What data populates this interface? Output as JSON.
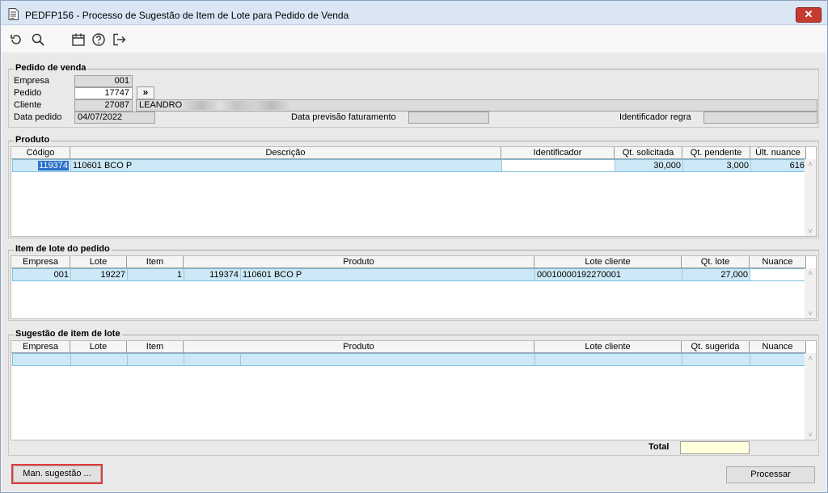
{
  "window": {
    "title": "PEDFP156 - Processo de Sugestão de Item de Lote para Pedido de Venda",
    "close_glyph": "✕"
  },
  "toolbar": {
    "icons": [
      "refresh-icon",
      "search-icon",
      "calendar-icon",
      "help-icon",
      "exit-icon"
    ]
  },
  "pedido": {
    "legend": "Pedido de venda",
    "empresa_label": "Empresa",
    "empresa_value": "001",
    "pedido_label": "Pedido",
    "pedido_value": "17747",
    "pedido_btn": "»",
    "cliente_label": "Cliente",
    "cliente_code": "27087",
    "cliente_name": "LEANDRO",
    "data_label": "Data pedido",
    "data_value": "04/07/2022",
    "previsao_label": "Data previsão faturamento",
    "previsao_value": "",
    "regra_label": "Identificador regra",
    "regra_value": ""
  },
  "produto": {
    "legend": "Produto",
    "headers": [
      "Código",
      "Descrição",
      "Identificador",
      "Qt. solicitada",
      "Qt. pendente",
      "Últ. nuance"
    ],
    "rows": [
      {
        "codigo": "119374",
        "descricao": "110601 BCO P",
        "identificador": "",
        "qt_solicitada": "30,000",
        "qt_pendente": "3,000",
        "ult_nuance": "616"
      }
    ]
  },
  "item_lote": {
    "legend": "Item de lote do pedido",
    "headers": [
      "Empresa",
      "Lote",
      "Item",
      "Produto",
      "Lote cliente",
      "Qt. lote",
      "Nuance"
    ],
    "rows": [
      {
        "empresa": "001",
        "lote": "19227",
        "item": "1",
        "produto_code": "119374",
        "produto_desc": "110601 BCO P",
        "lote_cliente": "00010000192270001",
        "qt_lote": "27,000",
        "nuance": ""
      }
    ]
  },
  "sugestao": {
    "legend": "Sugestão de item de lote",
    "headers": [
      "Empresa",
      "Lote",
      "Item",
      "Produto",
      "Lote cliente",
      "Qt. sugerida",
      "Nuance"
    ],
    "total_label": "Total",
    "total_value": ""
  },
  "footer": {
    "man_sugestao": "Man. sugestão ...",
    "processar": "Processar"
  }
}
